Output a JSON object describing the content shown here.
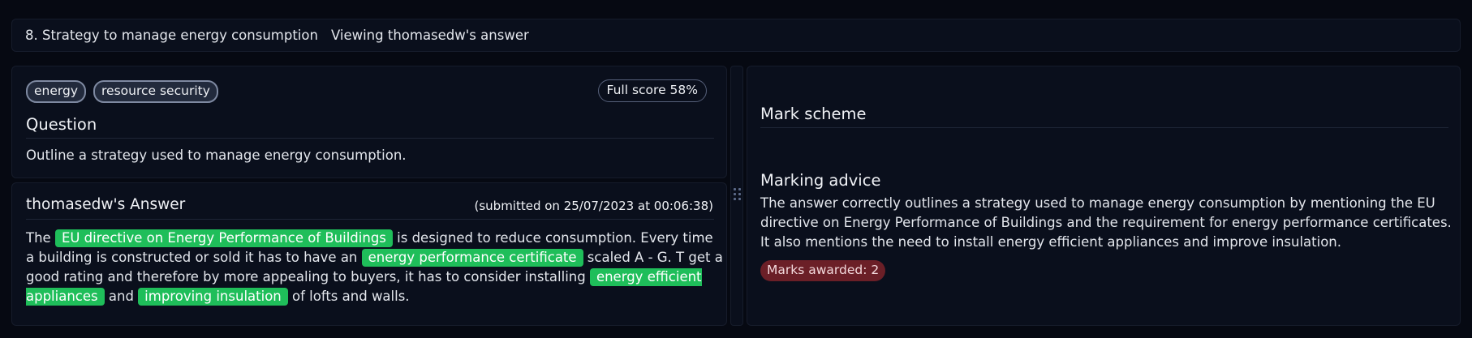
{
  "header": {
    "question_title": "8. Strategy to manage energy consumption",
    "viewing": "Viewing thomasedw's answer"
  },
  "question": {
    "tags": [
      "energy",
      "resource security"
    ],
    "full_score": "Full score 58%",
    "heading": "Question",
    "text": "Outline a strategy used to manage energy consumption."
  },
  "answer": {
    "heading": "thomasedw's Answer",
    "submitted": "(submitted on 25/07/2023 at 00:06:38)",
    "segments": {
      "t1": "The ",
      "h1": "EU directive on Energy Performance of Buildings",
      "t2": " is designed to reduce consumption. Every time a building is constructed or sold it has to have an ",
      "h2": "energy performance certificate",
      "t3": " scaled A - G. T get a good rating and therefore by more appealing to buyers, it has to consider installing ",
      "h3": "energy efficient appliances",
      "t4": " and ",
      "h4": "improving insulation",
      "t5": " of lofts and walls."
    },
    "highlight_color": "#1fbe5a"
  },
  "mark_scheme": {
    "heading": "Mark scheme",
    "advice_heading": "Marking advice",
    "advice_text": "The answer correctly outlines a strategy used to manage energy consumption by mentioning the EU directive on Energy Performance of Buildings and the requirement for energy performance certificates. It also mentions the need to install energy efficient appliances and improve insulation.",
    "marks_awarded": "Marks awarded: 2",
    "marks_color": "#6b1f27"
  },
  "icons": {
    "divider_handle": "drag-handle-icon"
  }
}
